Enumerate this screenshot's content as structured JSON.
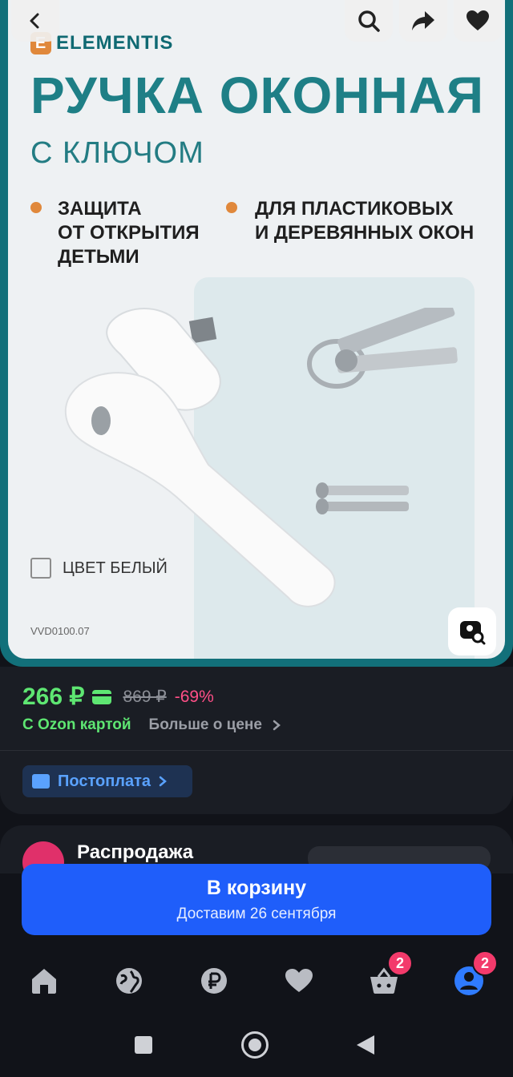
{
  "product_image": {
    "brand": "ELEMENTIS",
    "title_line1": "РУЧКА ОКОННАЯ",
    "title_line2": "С КЛЮЧОМ",
    "feature1": [
      "ЗАЩИТА",
      "ОТ ОТКРЫТИЯ",
      "ДЕТЬМИ"
    ],
    "feature2": [
      "ДЛЯ ПЛАСТИКОВЫХ",
      "И ДЕРЕВЯННЫХ ОКОН"
    ],
    "color_label": "ЦВЕТ БЕЛЫЙ",
    "sku": "VVD0100.07"
  },
  "price": {
    "current": "266 ₽",
    "old": "869 ₽",
    "discount": "-69%",
    "ozon_card_label": "С Ozon картой",
    "more_label": "Больше о цене",
    "postpay_label": "Постоплата"
  },
  "sale": {
    "title": "Распродажа"
  },
  "cart": {
    "label": "В корзину",
    "delivery": "Доставим 26 сентября"
  },
  "nav": {
    "cart_badge": "2",
    "profile_badge": "2"
  },
  "colors": {
    "accent_green": "#5ee672",
    "accent_blue": "#1f5efa",
    "discount_pink": "#ff4f87",
    "brand_teal": "#1e7f86"
  }
}
